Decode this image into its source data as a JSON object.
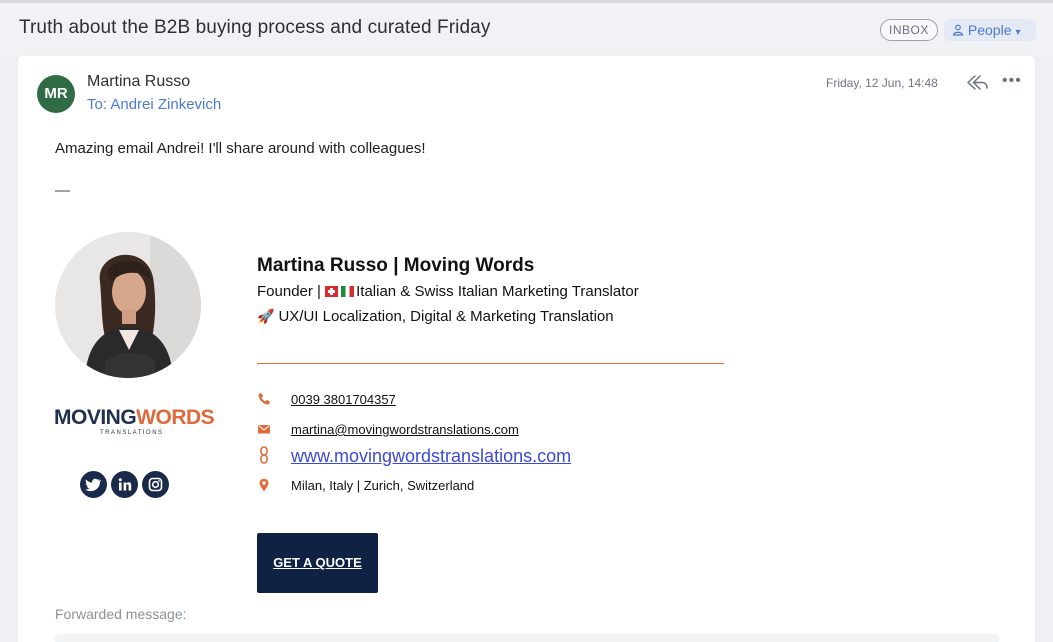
{
  "header": {
    "subject": "Truth about the B2B buying process and curated Friday",
    "badge": "INBOX",
    "people_label": "People"
  },
  "message": {
    "avatar_initials": "MR",
    "sender_name": "Martina Russo",
    "to_line": "To: Andrei Zinkevich",
    "date": "Friday, 12 Jun, 14:48",
    "body": "Amazing email Andrei! I'll share around with colleagues!",
    "separator": "—"
  },
  "signature": {
    "name": "Martina Russo | Moving Words",
    "role_prefix": "Founder |",
    "role_text": "Italian & Swiss Italian Marketing Translator",
    "tagline": "UX/UI Localization, Digital & Marketing Translation",
    "logo_moving": "MOVING",
    "logo_words": "WORDS",
    "logo_sub": "TRANSLATIONS",
    "phone": "0039 3801704357",
    "email": "martina@movingwordstranslations.com",
    "website": "www.movingwordstranslations.com",
    "location": "Milan, Italy | Zurich, Switzerland",
    "cta": "GET A QUOTE",
    "accent_color": "#e06a3c",
    "navy_color": "#0f2244",
    "socials": [
      "twitter-icon",
      "linkedin-icon",
      "instagram-icon"
    ]
  },
  "footer": {
    "forwarded_label": "Forwarded message:"
  }
}
